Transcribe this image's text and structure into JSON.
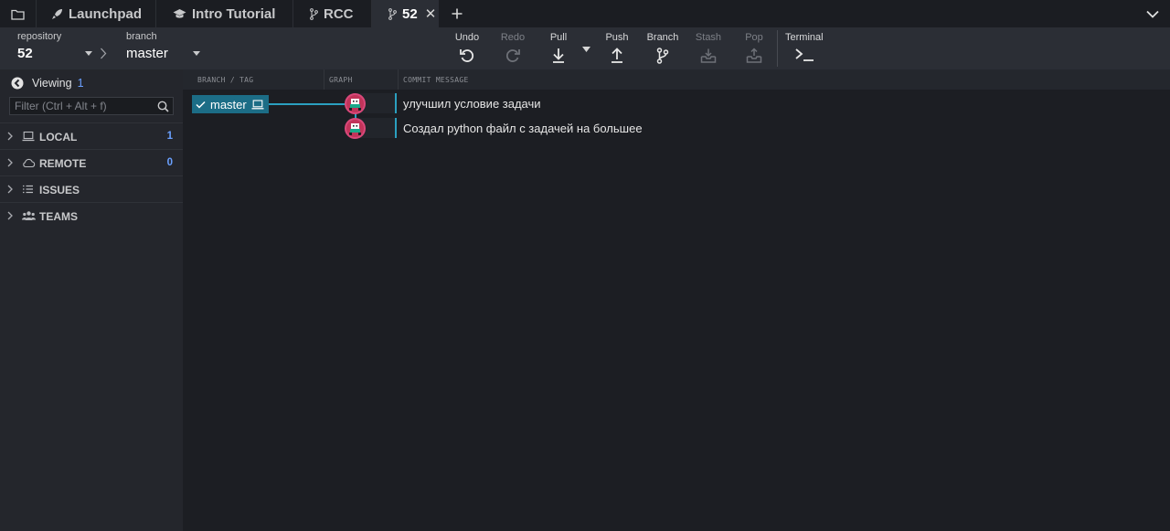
{
  "tabs": {
    "launchpad": "Launchpad",
    "intro": "Intro Tutorial",
    "rcc": "RCC",
    "current": "52",
    "close_glyph": "✕",
    "add_glyph": "+"
  },
  "toolbar": {
    "repository_label": "repository",
    "repository_value": "52",
    "branch_label": "branch",
    "branch_value": "master",
    "undo": "Undo",
    "redo": "Redo",
    "pull": "Pull",
    "push": "Push",
    "branch": "Branch",
    "stash": "Stash",
    "pop": "Pop",
    "terminal": "Terminal"
  },
  "sidebar": {
    "viewing_label": "Viewing",
    "viewing_count": "1",
    "filter_placeholder": "Filter (Ctrl + Alt + f)",
    "sections": [
      {
        "title": "LOCAL",
        "count": "1",
        "icon": "laptop-icon"
      },
      {
        "title": "REMOTE",
        "count": "0",
        "icon": "cloud-icon"
      },
      {
        "title": "ISSUES",
        "count": "",
        "icon": "list-icon"
      },
      {
        "title": "TEAMS",
        "count": "",
        "icon": "people-icon"
      }
    ]
  },
  "graph": {
    "headers": {
      "branch_tag": "BRANCH / TAG",
      "graph": "GRAPH",
      "commit_message": "COMMIT MESSAGE"
    },
    "branch_pill": "master",
    "commits": [
      {
        "message": "улучшил условие задачи"
      },
      {
        "message": "Создал python файл с задачей на большее"
      }
    ]
  },
  "colors": {
    "accent": "#1c6d86",
    "graph_line": "#2ba0c0",
    "avatar": "#c2345a",
    "count_blue": "#6aa0ff"
  }
}
